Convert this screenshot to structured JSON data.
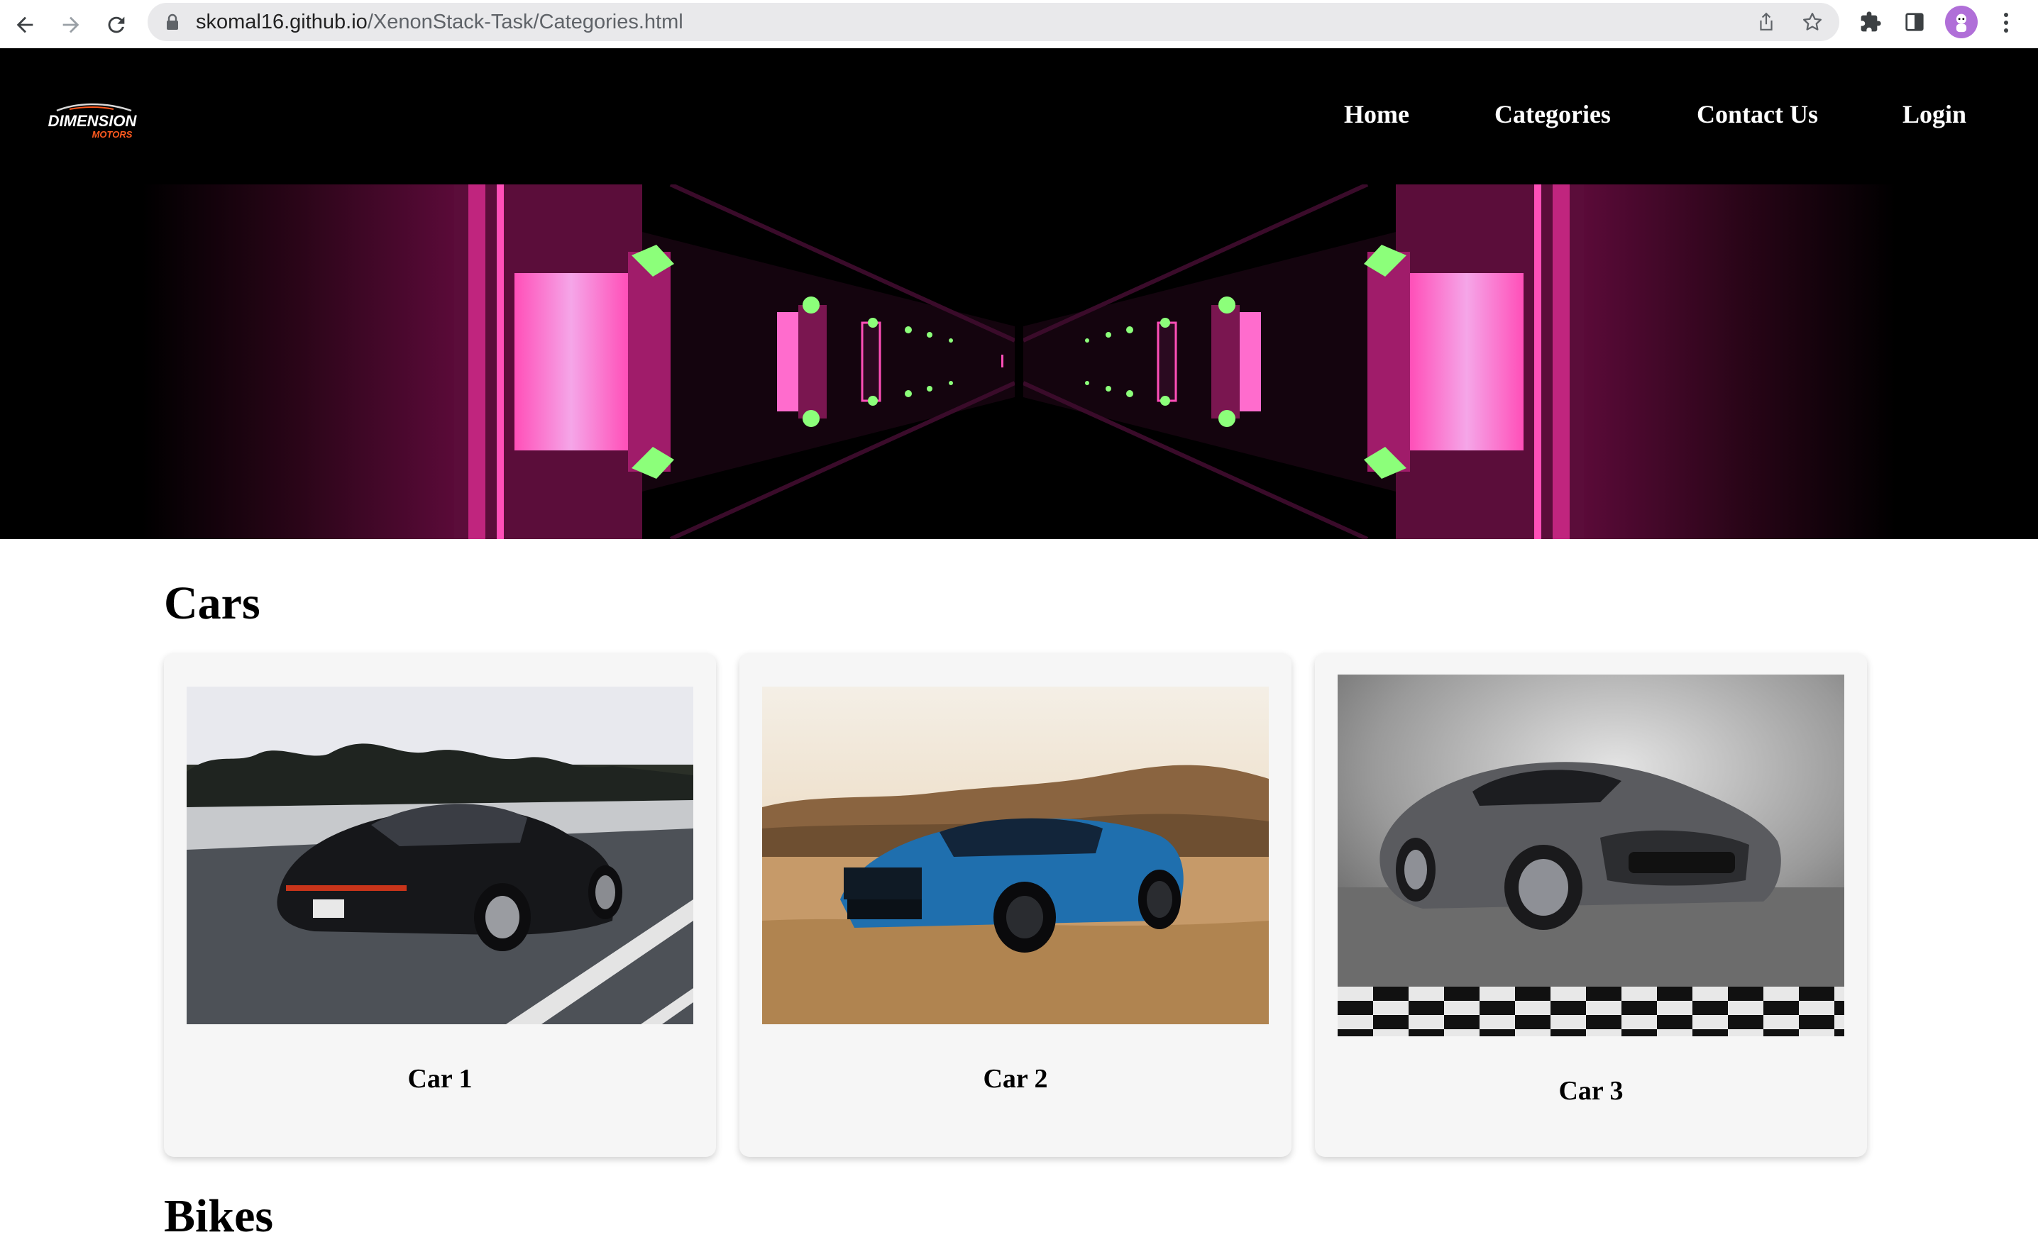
{
  "browser": {
    "url_host": "skomal16.github.io",
    "url_path": "/XenonStack-Task/Categories.html"
  },
  "header": {
    "logo": {
      "line1": "DIMENSION",
      "line2": "MOTORS"
    },
    "nav": [
      {
        "label": "Home"
      },
      {
        "label": "Categories"
      },
      {
        "label": "Contact Us"
      },
      {
        "label": "Login"
      }
    ]
  },
  "sections": [
    {
      "title": "Cars",
      "cards": [
        {
          "title": "Car 1"
        },
        {
          "title": "Car 2"
        },
        {
          "title": "Car 3"
        }
      ]
    },
    {
      "title": "Bikes"
    }
  ],
  "colors": {
    "header_bg": "#000000",
    "hero_pink": "#ff3fb0",
    "hero_green": "#66ff66",
    "logo_orange": "#ff5a1f"
  }
}
